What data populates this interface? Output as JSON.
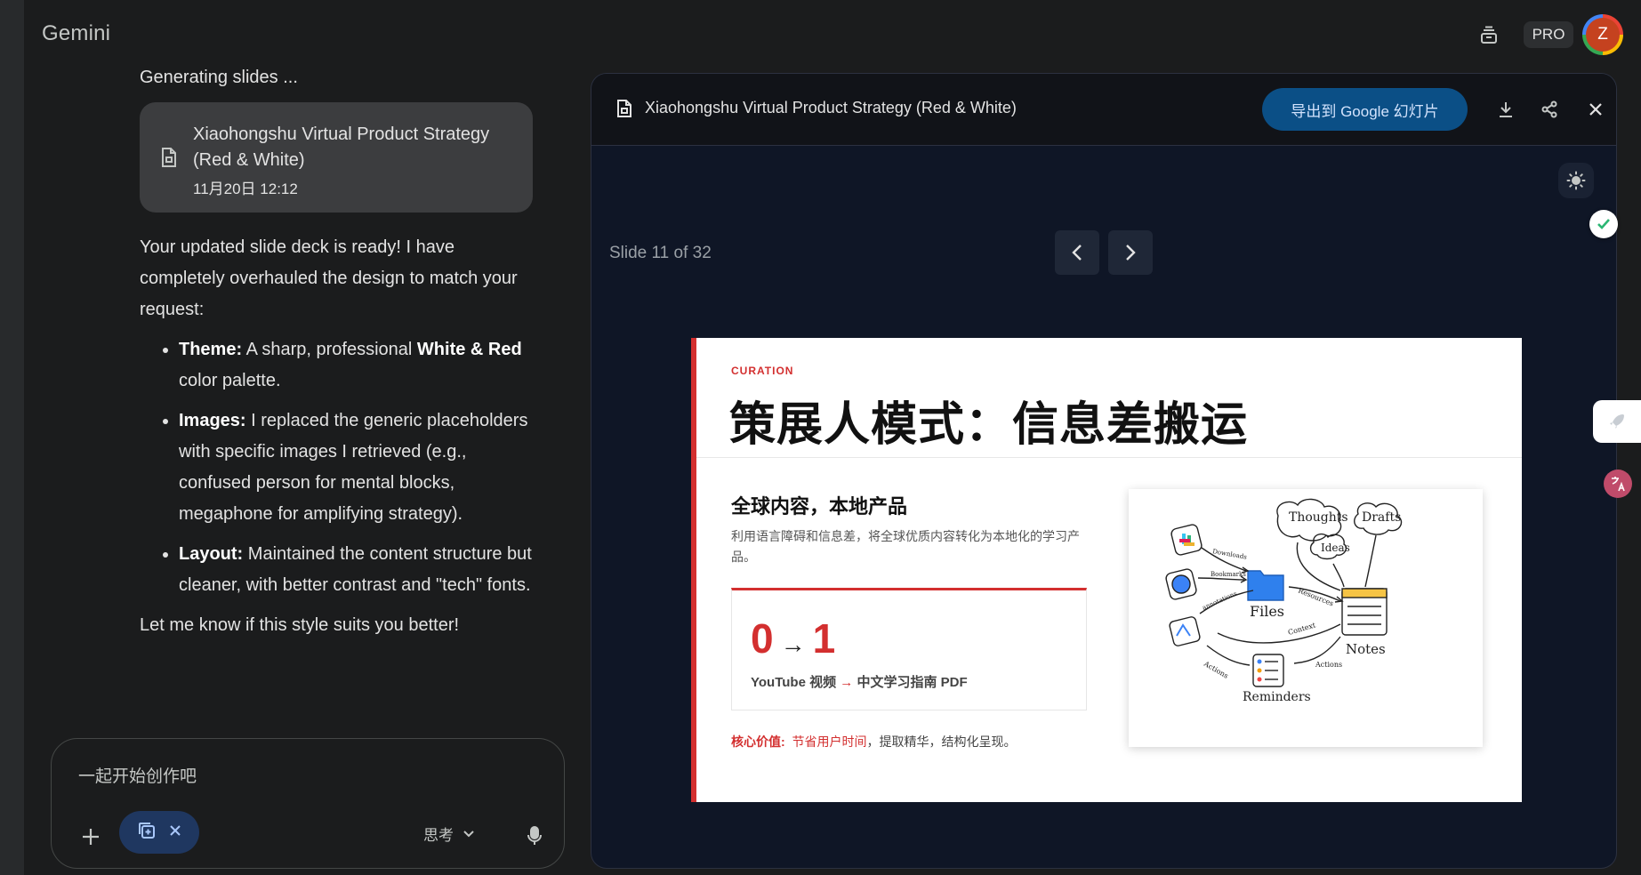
{
  "app": {
    "title": "Gemini"
  },
  "topbar": {
    "pro_label": "PRO",
    "avatar_initial": "Z"
  },
  "chat": {
    "status": "Generating slides ...",
    "file_card": {
      "title": "Xiaohongshu Virtual Product Strategy (Red & White)",
      "date": "11月20日 12:12"
    },
    "intro": "Your updated slide deck is ready! I have completely overhauled the design to match your request:",
    "bullets": [
      {
        "label": "Theme:",
        "text_a": "A sharp, professional ",
        "bold": "White & Red",
        "text_b": " color palette."
      },
      {
        "label": "Images:",
        "text": "I replaced the generic placeholders with specific images I retrieved (e.g., confused person for mental blocks, megaphone for amplifying strategy)."
      },
      {
        "label": "Layout:",
        "text": "Maintained the content structure but cleaner, with better contrast and \"tech\" fonts."
      }
    ],
    "closing": "Let me know if this style suits you better!"
  },
  "composer": {
    "placeholder": "一起开始创作吧",
    "mode_label": "思考"
  },
  "panel": {
    "title": "Xiaohongshu Virtual Product Strategy (Red & White)",
    "export_label": "导出到 Google 幻灯片",
    "slide_counter": "Slide 11 of 32"
  },
  "slide": {
    "tag": "CURATION",
    "title": "策展人模式：信息差搬运",
    "subtitle": "全球内容，本地产品",
    "description": "利用语言障碍和信息差，将全球优质内容转化为本地化的学习产品。",
    "metric_from": "0",
    "metric_arrow": "→",
    "metric_to": "1",
    "metric_caption_a": "YouTube 视频",
    "metric_caption_arrow": "→",
    "metric_caption_b": "中文学习指南 PDF",
    "core_label": "核心价值:",
    "core_red": "节省用户时间",
    "core_rest": "，提取精华，结构化呈现。",
    "sketch_labels": {
      "thoughts": "Thoughts",
      "drafts": "Drafts",
      "ideas": "Ideas",
      "files": "Files",
      "notes": "Notes",
      "reminders": "Reminders",
      "downloads": "Downloads",
      "bookmarks": "Bookmarks",
      "annotations": "annotations",
      "resources": "Resources",
      "context": "Context",
      "actions": "Actions",
      "actions2": "Actions"
    }
  },
  "colors": {
    "accent_red": "#d32f2f",
    "export_blue": "#0b4f86",
    "bg": "#1b1c1d",
    "panel_bg": "#0f1626"
  }
}
